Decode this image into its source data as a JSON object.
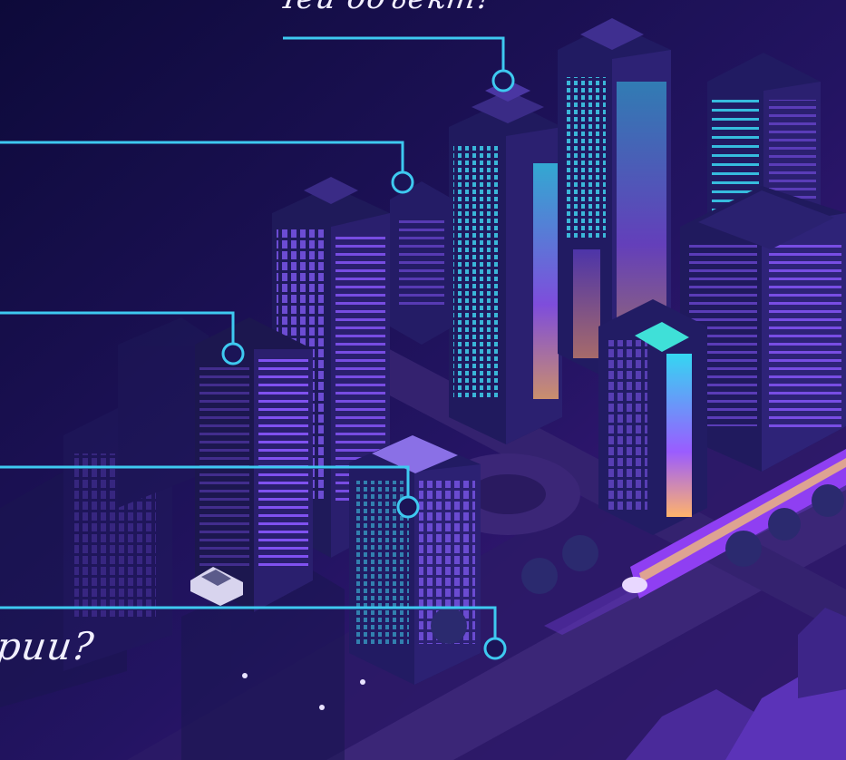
{
  "captions": {
    "top": "Чей объект?",
    "bottom": "рии?"
  },
  "colors": {
    "background_top": "#170d45",
    "background_bottom": "#4a1a86",
    "callout_line": "#3ec9f0",
    "window_cyan": "#35d6f2",
    "window_violet": "#9a5cff",
    "window_orange": "#ffb36b",
    "building_dark": "#1c174f",
    "building_mid": "#2b2070",
    "road": "#3b2677",
    "tree": "#2b2a6f",
    "train": "#8f3ff2"
  },
  "icons": [
    "callout-pin-icon",
    "taxi-icon",
    "train-icon",
    "tree-icon",
    "street-lamp-icon"
  ]
}
